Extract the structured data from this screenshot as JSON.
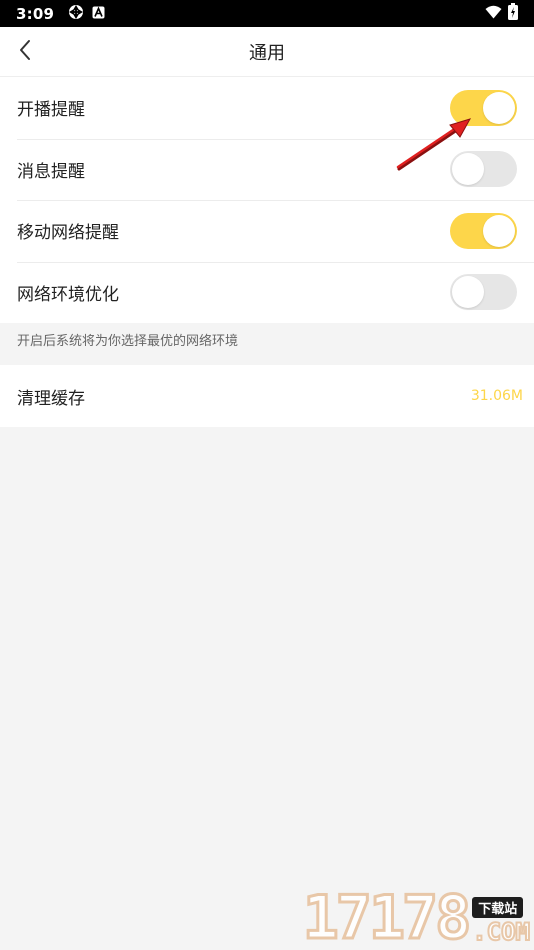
{
  "status_bar": {
    "time": "3:09"
  },
  "header": {
    "title": "通用"
  },
  "settings": [
    {
      "label": "开播提醒",
      "enabled": true
    },
    {
      "label": "消息提醒",
      "enabled": false
    },
    {
      "label": "移动网络提醒",
      "enabled": true
    },
    {
      "label": "网络环境优化",
      "enabled": false
    }
  ],
  "hint": "开启后系统将为你选择最优的网络环境",
  "cache": {
    "label": "清理缓存",
    "value": "31.06M"
  },
  "watermark": {
    "digits": "17178",
    "tag": "下载站",
    "domain": ".COM"
  },
  "colors": {
    "accent": "#fdd64a",
    "toggle_off": "#e6e6e6",
    "background": "#f4f4f4",
    "annotation": "#e02020"
  },
  "icons": {
    "back": "chevron-left-icon",
    "wifi": "wifi-icon",
    "battery": "battery-charging-icon"
  }
}
